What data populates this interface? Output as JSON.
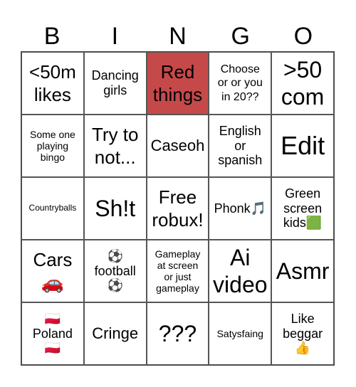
{
  "header": {
    "letters": [
      "B",
      "I",
      "N",
      "G",
      "O"
    ]
  },
  "colors": {
    "marked_cell": "#c6494a",
    "grid_line": "#555555",
    "background": "#ffffff",
    "text": "#000000"
  },
  "cells": [
    {
      "text": "<50m\nlikes",
      "marked": false
    },
    {
      "text": "Dancing\ngirls",
      "marked": false
    },
    {
      "text": "Red\nthings",
      "marked": true
    },
    {
      "text": "Choose\nor or you\nin 20??",
      "marked": false
    },
    {
      "text": ">50\ncom",
      "marked": false
    },
    {
      "text": "Some one\nplaying\nbingo",
      "marked": false
    },
    {
      "text": "Try to\nnot...",
      "marked": false
    },
    {
      "text": "Caseoh",
      "marked": false
    },
    {
      "text": "English\nor\nspanish",
      "marked": false
    },
    {
      "text": "Edit",
      "marked": false
    },
    {
      "text": "Countryballs",
      "marked": false
    },
    {
      "text": "Sh!t",
      "marked": false
    },
    {
      "text": "Free\nrobux!",
      "marked": false
    },
    {
      "text": "Phonk🎵",
      "marked": false
    },
    {
      "text": "Green\nscreen\nkids🟩",
      "marked": false
    },
    {
      "text": "Cars\n🚗",
      "marked": false
    },
    {
      "text": "⚽\nfootball\n⚽",
      "marked": false
    },
    {
      "text": "Gameplay\nat screen\nor just\ngameplay",
      "marked": false
    },
    {
      "text": "Ai\nvideo",
      "marked": false
    },
    {
      "text": "Asmr",
      "marked": false
    },
    {
      "text": "🇵🇱\nPoland\n🇵🇱",
      "marked": false
    },
    {
      "text": "Cringe",
      "marked": false
    },
    {
      "text": "???",
      "marked": false
    },
    {
      "text": "Satysfaing",
      "marked": false
    },
    {
      "text": "Like\nbeggar\n👍",
      "marked": false
    }
  ]
}
